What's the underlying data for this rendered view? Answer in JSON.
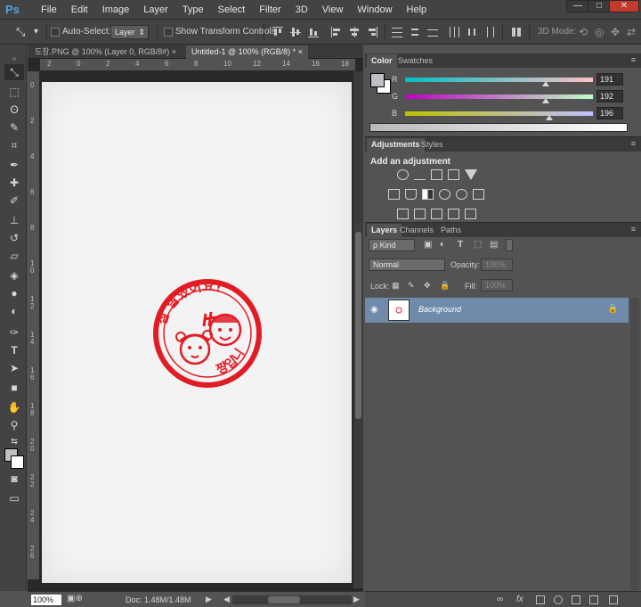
{
  "app": {
    "logo": "Ps"
  },
  "menu": [
    "File",
    "Edit",
    "Image",
    "Layer",
    "Type",
    "Select",
    "Filter",
    "3D",
    "View",
    "Window",
    "Help"
  ],
  "window_controls": {
    "minimize": "—",
    "maximize": "□",
    "close": "✕"
  },
  "options_bar": {
    "auto_select_label": "Auto-Select:",
    "auto_select_value": "Layer",
    "show_transform_label": "Show Transform Controls",
    "mode_3d_label": "3D Mode:"
  },
  "tabs": [
    {
      "label": "도장.PNG @ 100% (Layer 0, RGB/8#)"
    },
    {
      "label": "Untitled-1 @ 100% (RGB/8) *"
    }
  ],
  "ruler_top_ticks": [
    "2",
    "0",
    "2",
    "4",
    "6",
    "8",
    "10",
    "12",
    "14",
    "16",
    "18"
  ],
  "ruler_left_ticks": [
    "0",
    "2",
    "4",
    "6",
    "8",
    "1 0",
    "1 2",
    "1 4",
    "1 6",
    "1 8",
    "2 0",
    "2 2",
    "2 4",
    "2 6"
  ],
  "status": {
    "zoom": "100%",
    "doc_size": "Doc: 1.48M/1.48M"
  },
  "color_panel": {
    "tabs": [
      "Color",
      "Swatches"
    ],
    "channels": [
      {
        "label": "R",
        "value": "191",
        "level": 0.75
      },
      {
        "label": "G",
        "value": "192",
        "level": 0.75
      },
      {
        "label": "B",
        "value": "196",
        "level": 0.77
      }
    ],
    "foreground": "#bfc0c4",
    "background": "#ffffff"
  },
  "adjustments_panel": {
    "tabs": [
      "Adjustments",
      "Styles"
    ],
    "title": "Add an adjustment"
  },
  "layers_panel": {
    "tabs": [
      "Layers",
      "Channels",
      "Paths"
    ],
    "filter_kind": "ρ Kind",
    "blend_mode": "Normal",
    "opacity_label": "Opacity:",
    "opacity_value": "100%",
    "lock_label": "Lock:",
    "fill_label": "Fill:",
    "fill_value": "100%",
    "layers": [
      {
        "name": "Background",
        "visible": true,
        "locked": true
      }
    ]
  },
  "stamp": {
    "text": "참 잘했어요!",
    "bottom_text": "짱입니다",
    "color": "#e21c25"
  },
  "icons": {
    "move": "move-tool-icon",
    "eye": "eye-icon",
    "lock": "lock-icon"
  }
}
